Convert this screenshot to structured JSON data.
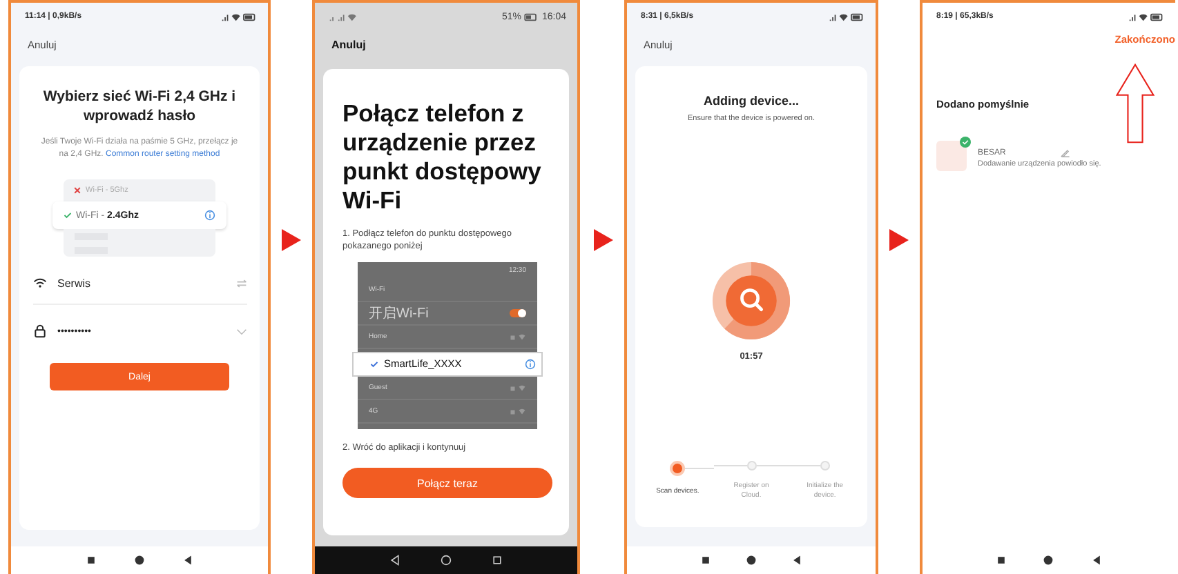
{
  "step1": {
    "status": "11:14 | 0,9kB/s",
    "cancel": "Anuluj",
    "title": "Wybierz sieć Wi-Fi 2,4 GHz i wprowadź hasło",
    "note": "Jeśli Twoje Wi-Fi działa na paśmie 5 GHz, przełącz je na 2,4 GHz.",
    "link": "Common router setting method",
    "networks": [
      {
        "label": "Wi-Fi - 5Ghz",
        "ok": false,
        "selected": false
      },
      {
        "label": "Wi-Fi - **2.4Ghz**",
        "ok": true,
        "selected": true
      }
    ],
    "ssid": "Serwis",
    "password": "••••••••••",
    "button": "Dalej"
  },
  "step2": {
    "status_battery": "51%",
    "status_time": "16:04",
    "cancel": "Anuluj",
    "title": "Połącz telefon z urządzenie przez punkt dostępowy Wi-Fi",
    "instruction": "1. Podłącz telefon do punktu dostępowego pokazanego poniżej",
    "mock": {
      "time": "12:30",
      "header": "Wi-Fi",
      "toggle": "开启Wi-Fi",
      "toggle_on": true,
      "rows": [
        "Home",
        "Guest",
        "4G"
      ],
      "highlight": "SmartLife_XXXX"
    },
    "next_step": "2. Wróć do aplikacji i kontynuuj",
    "button": "Połącz teraz"
  },
  "step3": {
    "status": "8:31 | 6,5kB/s",
    "cancel": "Anuluj",
    "title": "Adding device...",
    "subtitle": "Ensure that the device is powered on.",
    "timer": "01:57",
    "steps": [
      {
        "label": "Scan devices.",
        "active": true
      },
      {
        "label": "Register on Cloud.",
        "active": false
      },
      {
        "label": "Initialize the device.",
        "active": false
      }
    ]
  },
  "step4": {
    "status": "8:19 | 65,3kB/s",
    "done": "Zakończono",
    "title": "Dodano pomyślnie",
    "device": "BESAR",
    "result": "Dodawanie urządzenia powiodło się."
  }
}
